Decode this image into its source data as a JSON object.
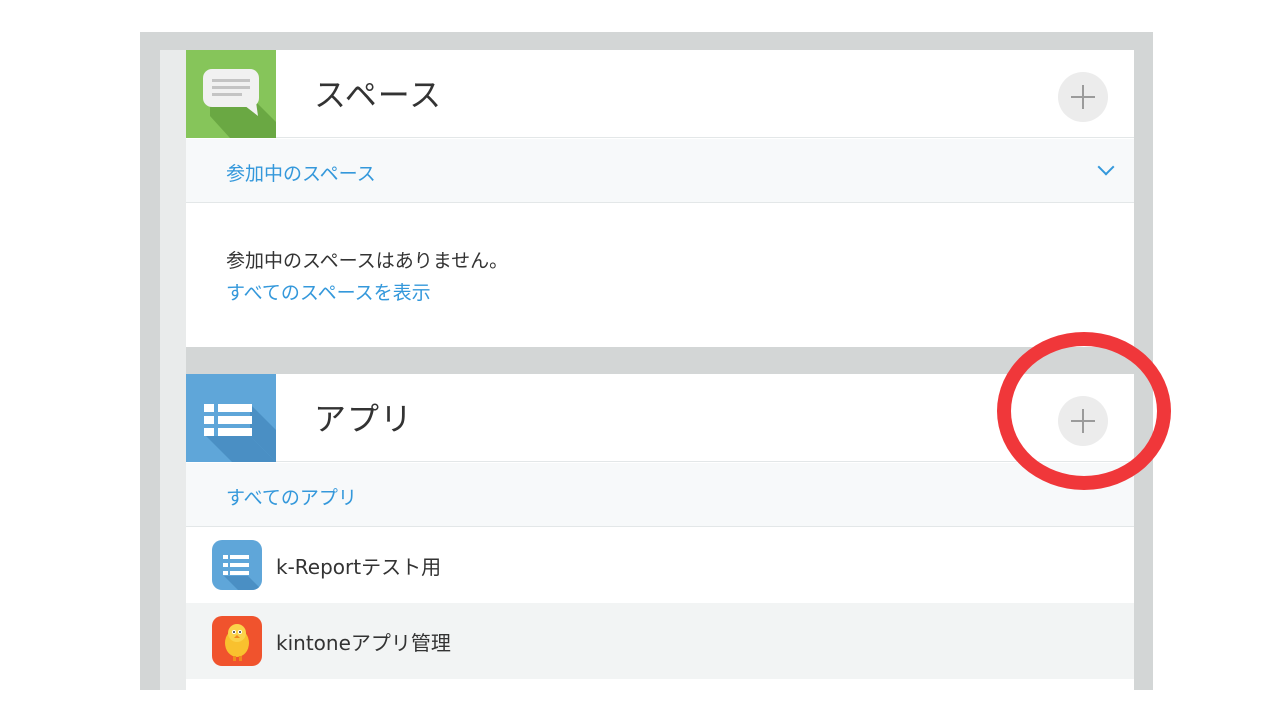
{
  "spaces": {
    "title": "スペース",
    "subheader": "参加中のスペース",
    "empty_message": "参加中のスペースはありません。",
    "view_all_link": "すべてのスペースを表示"
  },
  "apps": {
    "title": "アプリ",
    "subheader": "すべてのアプリ",
    "items": [
      {
        "name": "k-Reportテスト用",
        "icon": "list-icon"
      },
      {
        "name": "kintoneアプリ管理",
        "icon": "kintone-bird-icon"
      }
    ]
  },
  "colors": {
    "space_icon_bg": "#86c55a",
    "app_icon_bg": "#5fa6d9",
    "link": "#3498db",
    "highlight_circle": "#f0373a"
  }
}
